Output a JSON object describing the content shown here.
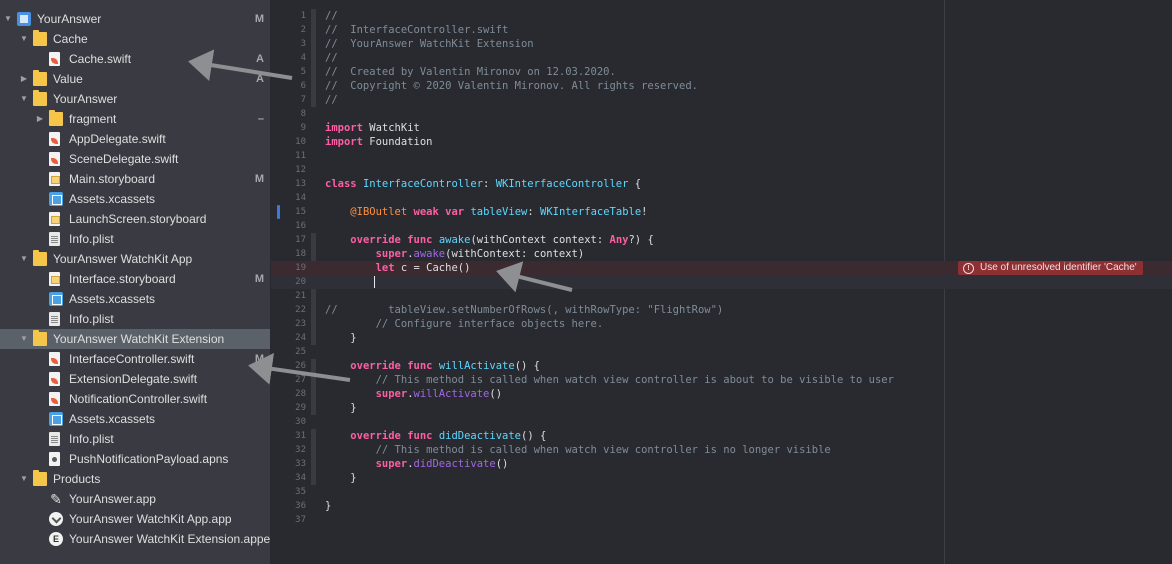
{
  "navigator": {
    "items": [
      {
        "label": "YourAnswer",
        "badge": "M",
        "icon": "project-icon",
        "depth": 0,
        "disclosure": "open"
      },
      {
        "label": "Cache",
        "badge": "",
        "icon": "folder-icon",
        "depth": 1,
        "disclosure": "open"
      },
      {
        "label": "Cache.swift",
        "badge": "A",
        "icon": "swift-file-icon",
        "depth": 2,
        "disclosure": ""
      },
      {
        "label": "Value",
        "badge": "A",
        "icon": "folder-icon",
        "depth": 1,
        "disclosure": "closed"
      },
      {
        "label": "YourAnswer",
        "badge": "",
        "icon": "folder-icon",
        "depth": 1,
        "disclosure": "open"
      },
      {
        "label": "fragment",
        "badge": "–",
        "icon": "folder-icon",
        "depth": 2,
        "disclosure": "closed"
      },
      {
        "label": "AppDelegate.swift",
        "badge": "",
        "icon": "swift-file-icon",
        "depth": 2,
        "disclosure": ""
      },
      {
        "label": "SceneDelegate.swift",
        "badge": "",
        "icon": "swift-file-icon",
        "depth": 2,
        "disclosure": ""
      },
      {
        "label": "Main.storyboard",
        "badge": "M",
        "icon": "storyboard-icon",
        "depth": 2,
        "disclosure": ""
      },
      {
        "label": "Assets.xcassets",
        "badge": "",
        "icon": "assets-icon",
        "depth": 2,
        "disclosure": ""
      },
      {
        "label": "LaunchScreen.storyboard",
        "badge": "",
        "icon": "storyboard-icon",
        "depth": 2,
        "disclosure": ""
      },
      {
        "label": "Info.plist",
        "badge": "",
        "icon": "plist-icon",
        "depth": 2,
        "disclosure": ""
      },
      {
        "label": "YourAnswer WatchKit App",
        "badge": "",
        "icon": "folder-icon",
        "depth": 1,
        "disclosure": "open"
      },
      {
        "label": "Interface.storyboard",
        "badge": "M",
        "icon": "storyboard-icon",
        "depth": 2,
        "disclosure": ""
      },
      {
        "label": "Assets.xcassets",
        "badge": "",
        "icon": "assets-icon",
        "depth": 2,
        "disclosure": ""
      },
      {
        "label": "Info.plist",
        "badge": "",
        "icon": "plist-icon",
        "depth": 2,
        "disclosure": ""
      },
      {
        "label": "YourAnswer WatchKit Extension",
        "badge": "",
        "icon": "folder-icon",
        "depth": 1,
        "disclosure": "open",
        "selected": true
      },
      {
        "label": "InterfaceController.swift",
        "badge": "M",
        "icon": "swift-file-icon",
        "depth": 2,
        "disclosure": ""
      },
      {
        "label": "ExtensionDelegate.swift",
        "badge": "",
        "icon": "swift-file-icon",
        "depth": 2,
        "disclosure": ""
      },
      {
        "label": "NotificationController.swift",
        "badge": "",
        "icon": "swift-file-icon",
        "depth": 2,
        "disclosure": ""
      },
      {
        "label": "Assets.xcassets",
        "badge": "",
        "icon": "assets-icon",
        "depth": 2,
        "disclosure": ""
      },
      {
        "label": "Info.plist",
        "badge": "",
        "icon": "plist-icon",
        "depth": 2,
        "disclosure": ""
      },
      {
        "label": "PushNotificationPayload.apns",
        "badge": "",
        "icon": "apns-file-icon",
        "depth": 2,
        "disclosure": ""
      },
      {
        "label": "Products",
        "badge": "",
        "icon": "folder-icon",
        "depth": 1,
        "disclosure": "open"
      },
      {
        "label": "YourAnswer.app",
        "badge": "",
        "icon": "app-icon",
        "depth": 2,
        "disclosure": ""
      },
      {
        "label": "YourAnswer WatchKit App.app",
        "badge": "",
        "icon": "watch-app-icon",
        "depth": 2,
        "disclosure": ""
      },
      {
        "label": "YourAnswer WatchKit Extension.appex",
        "badge": "",
        "icon": "extension-icon",
        "depth": 2,
        "disclosure": ""
      }
    ]
  },
  "editor": {
    "lines": [
      {
        "n": "1",
        "t": [
          [
            "c-com",
            "//"
          ]
        ]
      },
      {
        "n": "2",
        "t": [
          [
            "c-com",
            "//  InterfaceController.swift"
          ]
        ]
      },
      {
        "n": "3",
        "t": [
          [
            "c-com",
            "//  YourAnswer WatchKit Extension"
          ]
        ]
      },
      {
        "n": "4",
        "t": [
          [
            "c-com",
            "//"
          ]
        ]
      },
      {
        "n": "5",
        "t": [
          [
            "c-com",
            "//  Created by Valentin Mironov on 12.03.2020."
          ]
        ]
      },
      {
        "n": "6",
        "t": [
          [
            "c-com",
            "//  Copyright © 2020 Valentin Mironov. All rights reserved."
          ]
        ]
      },
      {
        "n": "7",
        "t": [
          [
            "c-com",
            "//"
          ]
        ]
      },
      {
        "n": "8",
        "t": []
      },
      {
        "n": "9",
        "t": [
          [
            "c-kw",
            "import"
          ],
          [
            "",
            " WatchKit"
          ]
        ]
      },
      {
        "n": "10",
        "t": [
          [
            "c-kw",
            "import"
          ],
          [
            "",
            " Foundation"
          ]
        ]
      },
      {
        "n": "11",
        "t": []
      },
      {
        "n": "12",
        "t": []
      },
      {
        "n": "13",
        "t": [
          [
            "c-kw",
            "class"
          ],
          [
            "",
            " "
          ],
          [
            "c-type",
            "InterfaceController"
          ],
          [
            "",
            ": "
          ],
          [
            "c-type",
            "WKInterfaceController"
          ],
          [
            "",
            " {"
          ]
        ]
      },
      {
        "n": "14",
        "t": []
      },
      {
        "n": "15",
        "t": [
          [
            "",
            "    "
          ],
          [
            "c-attr",
            "@IBOutlet"
          ],
          [
            "",
            " "
          ],
          [
            "c-kw",
            "weak"
          ],
          [
            "",
            " "
          ],
          [
            "c-kw",
            "var"
          ],
          [
            "",
            " "
          ],
          [
            "c-type",
            "tableView"
          ],
          [
            "",
            ": "
          ],
          [
            "c-type",
            "WKInterfaceTable"
          ],
          [
            "",
            "!"
          ]
        ]
      },
      {
        "n": "16",
        "t": []
      },
      {
        "n": "17",
        "t": [
          [
            "",
            "    "
          ],
          [
            "c-kw",
            "override"
          ],
          [
            "",
            " "
          ],
          [
            "c-kw",
            "func"
          ],
          [
            "",
            " "
          ],
          [
            "c-type",
            "awake"
          ],
          [
            "",
            "(withContext context: "
          ],
          [
            "c-kw",
            "Any"
          ],
          [
            "",
            "?) {"
          ]
        ]
      },
      {
        "n": "18",
        "t": [
          [
            "",
            "        "
          ],
          [
            "c-kw",
            "super"
          ],
          [
            "",
            "."
          ],
          [
            "c-call",
            "awake"
          ],
          [
            "",
            "(withContext: context)"
          ]
        ]
      },
      {
        "n": "19",
        "t": [
          [
            "",
            "        "
          ],
          [
            "c-kw",
            "let"
          ],
          [
            "",
            " c = Cache()"
          ]
        ]
      },
      {
        "n": "20",
        "t": [
          [
            "",
            "        "
          ]
        ]
      },
      {
        "n": "21",
        "t": []
      },
      {
        "n": "22",
        "t": [
          [
            "c-com",
            "//        tableView.setNumberOfRows(, withRowType: \"FlightRow\")"
          ]
        ]
      },
      {
        "n": "23",
        "t": [
          [
            "c-com",
            "        // Configure interface objects here."
          ]
        ]
      },
      {
        "n": "24",
        "t": [
          [
            "",
            "    }"
          ]
        ]
      },
      {
        "n": "25",
        "t": []
      },
      {
        "n": "26",
        "t": [
          [
            "",
            "    "
          ],
          [
            "c-kw",
            "override"
          ],
          [
            "",
            " "
          ],
          [
            "c-kw",
            "func"
          ],
          [
            "",
            " "
          ],
          [
            "c-type",
            "willActivate"
          ],
          [
            "",
            "() {"
          ]
        ]
      },
      {
        "n": "27",
        "t": [
          [
            "c-com",
            "        // This method is called when watch view controller is about to be visible to user"
          ]
        ]
      },
      {
        "n": "28",
        "t": [
          [
            "",
            "        "
          ],
          [
            "c-kw",
            "super"
          ],
          [
            "",
            "."
          ],
          [
            "c-call",
            "willActivate"
          ],
          [
            "",
            "()"
          ]
        ]
      },
      {
        "n": "29",
        "t": [
          [
            "",
            "    }"
          ]
        ]
      },
      {
        "n": "30",
        "t": []
      },
      {
        "n": "31",
        "t": [
          [
            "",
            "    "
          ],
          [
            "c-kw",
            "override"
          ],
          [
            "",
            " "
          ],
          [
            "c-kw",
            "func"
          ],
          [
            "",
            " "
          ],
          [
            "c-type",
            "didDeactivate"
          ],
          [
            "",
            "() {"
          ]
        ]
      },
      {
        "n": "32",
        "t": [
          [
            "c-com",
            "        // This method is called when watch view controller is no longer visible"
          ]
        ]
      },
      {
        "n": "33",
        "t": [
          [
            "",
            "        "
          ],
          [
            "c-kw",
            "super"
          ],
          [
            "",
            "."
          ],
          [
            "c-call",
            "didDeactivate"
          ],
          [
            "",
            "()"
          ]
        ]
      },
      {
        "n": "34",
        "t": [
          [
            "",
            "    }"
          ]
        ]
      },
      {
        "n": "35",
        "t": []
      },
      {
        "n": "36",
        "t": [
          [
            "",
            "}"
          ]
        ]
      },
      {
        "n": "37",
        "t": []
      }
    ],
    "error_message": "Use of unresolved identifier 'Cache'",
    "error_line": "19",
    "current_line": "20"
  },
  "colors": {
    "navigator_bg": "#3a3b42",
    "editor_bg": "#292a30",
    "selection": "#5b6168",
    "keyword": "#fc5fa3",
    "type": "#5dd8ff",
    "comment": "#7f8c98",
    "error_bg": "#8c3034",
    "folder": "#f5c64a"
  }
}
